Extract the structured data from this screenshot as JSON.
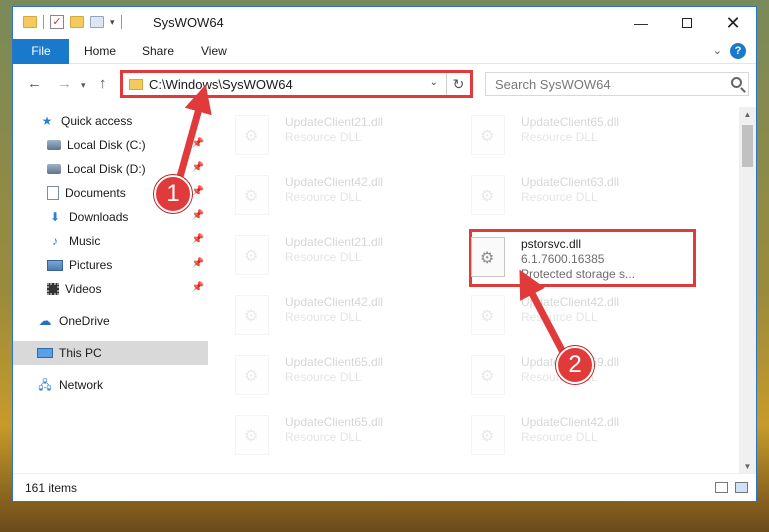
{
  "window": {
    "title": "SysWOW64",
    "controls": {
      "minimize": "—",
      "close": "✕"
    }
  },
  "ribbon": {
    "tabs": [
      "File",
      "Home",
      "Share",
      "View"
    ],
    "help": "?"
  },
  "address_bar": {
    "path": "C:\\Windows\\SysWOW64",
    "search_placeholder": "Search SysWOW64"
  },
  "nav_pane": {
    "items": [
      {
        "label": "Quick access",
        "icon": "star-icon",
        "pinned": false
      },
      {
        "label": "Local Disk (C:)",
        "icon": "disk-icon",
        "pinned": true
      },
      {
        "label": "Local Disk (D:)",
        "icon": "disk-icon",
        "pinned": true
      },
      {
        "label": "Documents",
        "icon": "documents-icon",
        "pinned": true
      },
      {
        "label": "Downloads",
        "icon": "downloads-icon",
        "pinned": true
      },
      {
        "label": "Music",
        "icon": "music-icon",
        "pinned": true
      },
      {
        "label": "Pictures",
        "icon": "pictures-icon",
        "pinned": true
      },
      {
        "label": "Videos",
        "icon": "videos-icon",
        "pinned": true
      },
      {
        "label": "OneDrive",
        "icon": "cloud-icon",
        "pinned": false
      },
      {
        "label": "This PC",
        "icon": "pc-icon",
        "pinned": false,
        "selected": true
      },
      {
        "label": "Network",
        "icon": "network-icon",
        "pinned": false
      }
    ]
  },
  "files": [
    {
      "name": "UpdateClient21.dll",
      "type": "Resource DLL",
      "faded": true
    },
    {
      "name": "UpdateClient65.dll",
      "type": "Resource DLL",
      "faded": true
    },
    {
      "name": "UpdateClient42.dll",
      "type": "Resource DLL",
      "faded": true
    },
    {
      "name": "UpdateClient63.dll",
      "type": "Resource DLL",
      "faded": true
    },
    {
      "name": "UpdateClient21.dll",
      "type": "Resource DLL",
      "faded": true
    },
    {
      "name": "pstorsvc.dll",
      "version": "6.1.7600.16385",
      "type": "Protected storage s...",
      "faded": false,
      "highlighted": true
    },
    {
      "name": "UpdateClient42.dll",
      "type": "Resource DLL",
      "faded": true
    },
    {
      "name": "UpdateClient42.dll",
      "type": "Resource DLL",
      "faded": true
    },
    {
      "name": "UpdateClient65.dll",
      "type": "Resource DLL",
      "faded": true
    },
    {
      "name": "UpdateClient69.dll",
      "type": "Resource DLL",
      "faded": true
    },
    {
      "name": "UpdateClient65.dll",
      "type": "Resource DLL",
      "faded": true
    },
    {
      "name": "UpdateClient42.dll",
      "type": "Resource DLL",
      "faded": true
    }
  ],
  "status_bar": {
    "item_count": "161 items"
  },
  "annotations": {
    "badge_1": "1",
    "badge_2": "2",
    "color": "#e03a3a"
  }
}
